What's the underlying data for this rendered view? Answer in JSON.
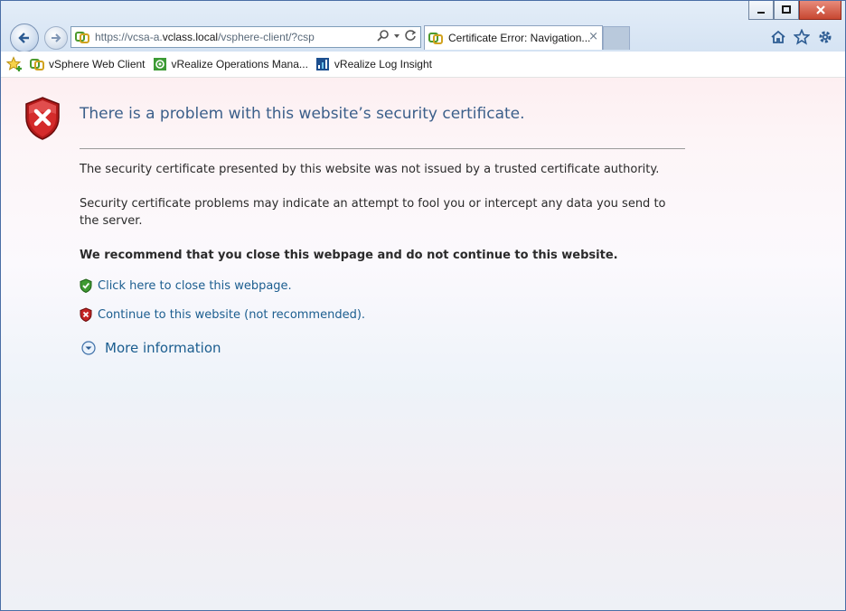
{
  "window": {
    "controls": [
      "minimize",
      "maximize",
      "close"
    ]
  },
  "address": {
    "url_prefix": "https://vcsa-a.",
    "url_domain": "vclass.local",
    "url_path": "/vsphere-client/?csp",
    "icon": "certificate-error-icon"
  },
  "tab": {
    "label": "Certificate Error: Navigation...",
    "close": "×"
  },
  "favorites": [
    {
      "label": "vSphere Web Client",
      "icon": "vsphere-icon"
    },
    {
      "label": "vRealize Operations Mana...",
      "icon": "vrealize-operations-icon"
    },
    {
      "label": "vRealize Log Insight",
      "icon": "log-insight-icon"
    }
  ],
  "page": {
    "title": "There is a problem with this website’s security certificate.",
    "para1": "The security certificate presented by this website was not issued by a trusted certificate authority.",
    "para2": "Security certificate problems may indicate an attempt to fool you or intercept any data you send to the server.",
    "recommend": "We recommend that you close this webpage and do not continue to this website.",
    "close_link": "Click here to close this webpage.",
    "continue_link": "Continue to this website (not recommended).",
    "more_info": "More information"
  },
  "colors": {
    "title": "#3b5f8a",
    "link": "#1b5d8f",
    "close_button": "#c74731"
  }
}
